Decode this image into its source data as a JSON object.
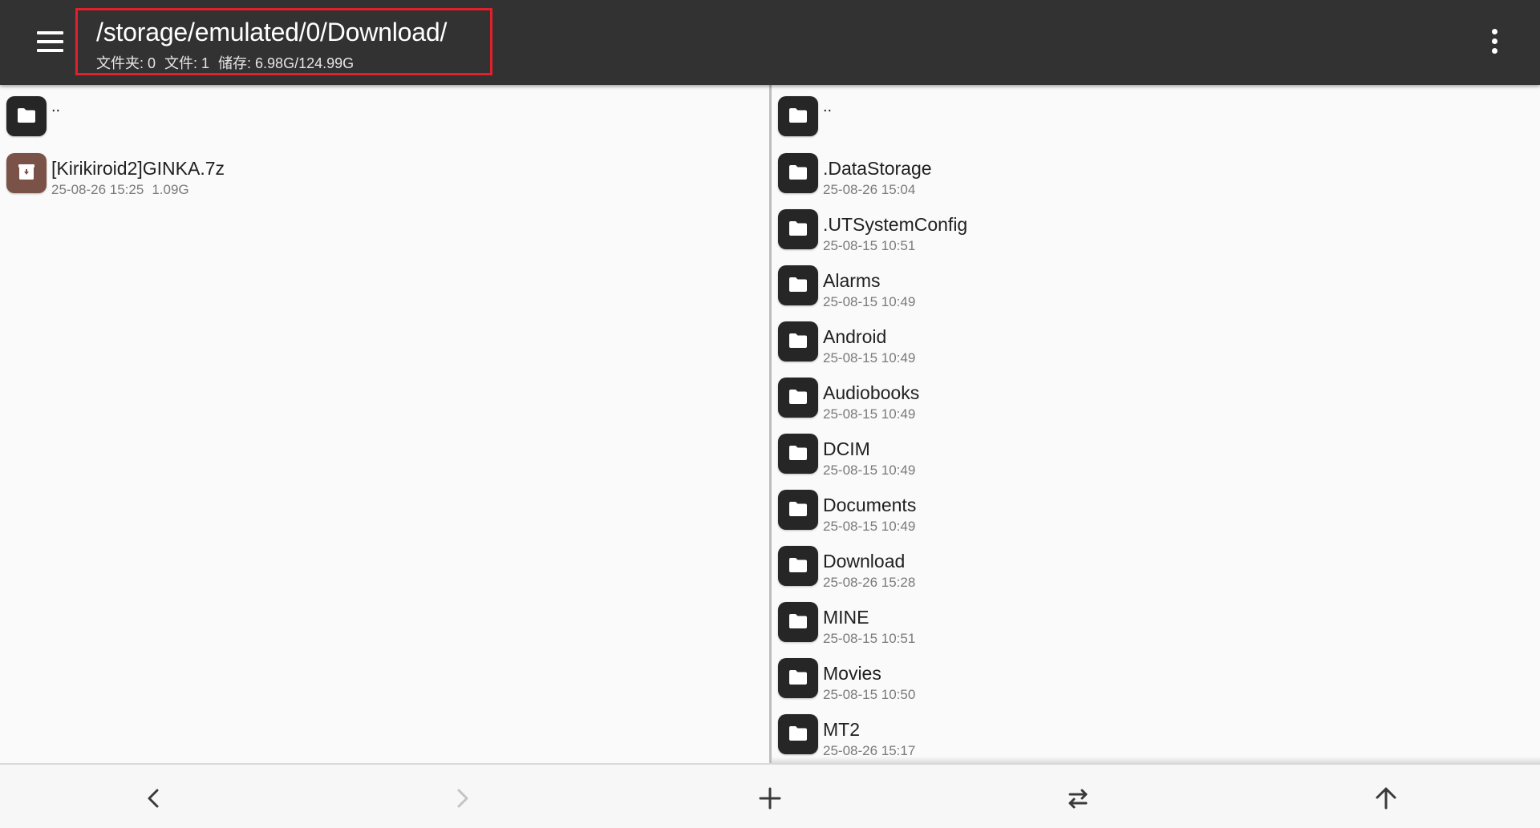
{
  "header": {
    "path": "/storage/emulated/0/Download/",
    "stats": [
      "文件夹: 0",
      "文件: 1",
      "储存: 6.98G/124.99G"
    ],
    "menu_icon": "hamburger-menu-icon",
    "overflow_icon": "more-vert-icon"
  },
  "left_pane": {
    "parent_label": "..",
    "files": [
      {
        "name": "[Kirikiroid2]GINKA.7z",
        "date": "25-08-26 15:25",
        "size": "1.09G",
        "icon": "archive-icon"
      }
    ]
  },
  "right_pane": {
    "parent_label": "..",
    "folders": [
      {
        "name": ".DataStorage",
        "date": "25-08-26 15:04"
      },
      {
        "name": ".UTSystemConfig",
        "date": "25-08-15 10:51"
      },
      {
        "name": "Alarms",
        "date": "25-08-15 10:49"
      },
      {
        "name": "Android",
        "date": "25-08-15 10:49"
      },
      {
        "name": "Audiobooks",
        "date": "25-08-15 10:49"
      },
      {
        "name": "DCIM",
        "date": "25-08-15 10:49"
      },
      {
        "name": "Documents",
        "date": "25-08-15 10:49"
      },
      {
        "name": "Download",
        "date": "25-08-26 15:28"
      },
      {
        "name": "MINE",
        "date": "25-08-15 10:51"
      },
      {
        "name": "Movies",
        "date": "25-08-15 10:50"
      },
      {
        "name": "MT2",
        "date": "25-08-26 15:17"
      }
    ]
  },
  "bottom_bar": {
    "buttons": [
      "back-icon",
      "forward-icon",
      "add-icon",
      "swap-panes-icon",
      "up-arrow-icon"
    ]
  },
  "colors": {
    "topbar": "#323232",
    "highlight_border": "#e0212b",
    "folder_icon_bg": "#262626",
    "archive_icon_bg": "#7a5248"
  }
}
